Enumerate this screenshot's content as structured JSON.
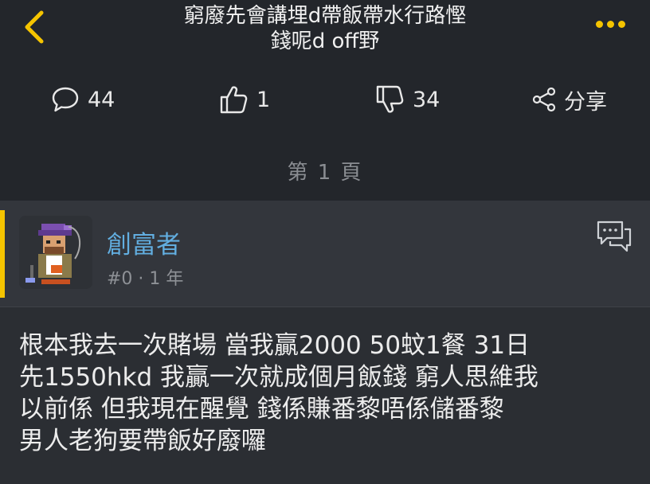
{
  "header": {
    "title_line1": "窮廢先會講埋d帶飯帶水行路慳",
    "title_line2": "錢呢d off野"
  },
  "stats": {
    "comments": "44",
    "likes": "1",
    "dislikes": "34",
    "share_label": "分享"
  },
  "page_indicator": "第 1 頁",
  "post": {
    "username": "創富者",
    "meta": "#0  · 1 年",
    "content_lines": [
      "根本我去一次賭場  當我贏2000  50蚊1餐  31日",
      "先1550hkd  我贏一次就成個月飯錢 窮人思維我",
      "以前係  但我現在醒覺  錢係賺番黎唔係儲番黎",
      "男人老狗要帶飯好廢囉"
    ]
  },
  "colors": {
    "accent": "#f5c400",
    "username": "#62aee0",
    "background": "#2b2e33",
    "header_bg": "#23262b"
  }
}
